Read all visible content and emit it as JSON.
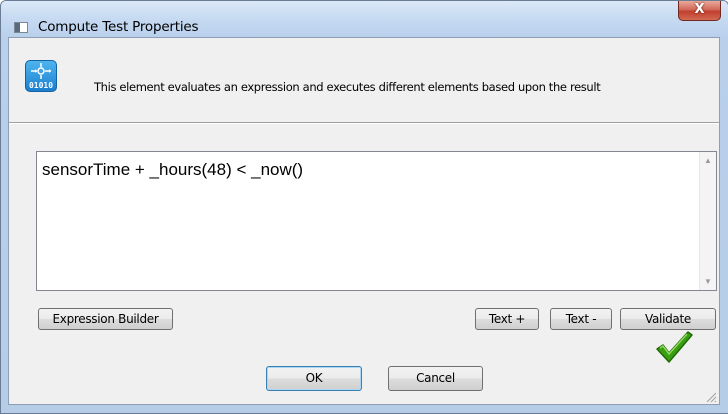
{
  "window": {
    "title": "Compute Test Properties",
    "close_symbol": "X"
  },
  "header": {
    "icon": "compute-test-icon",
    "description": "This element evaluates an expression and executes different elements based upon the result"
  },
  "expression": {
    "value": "sensorTime + _hours(48) < _now()"
  },
  "buttons": {
    "expression_builder": "Expression Builder",
    "text_plus": "Text +",
    "text_minus": "Text -",
    "validate": "Validate",
    "ok": "OK",
    "cancel": "Cancel"
  },
  "validation": {
    "icon": "green-checkmark-icon",
    "color": "#3a9d12"
  }
}
